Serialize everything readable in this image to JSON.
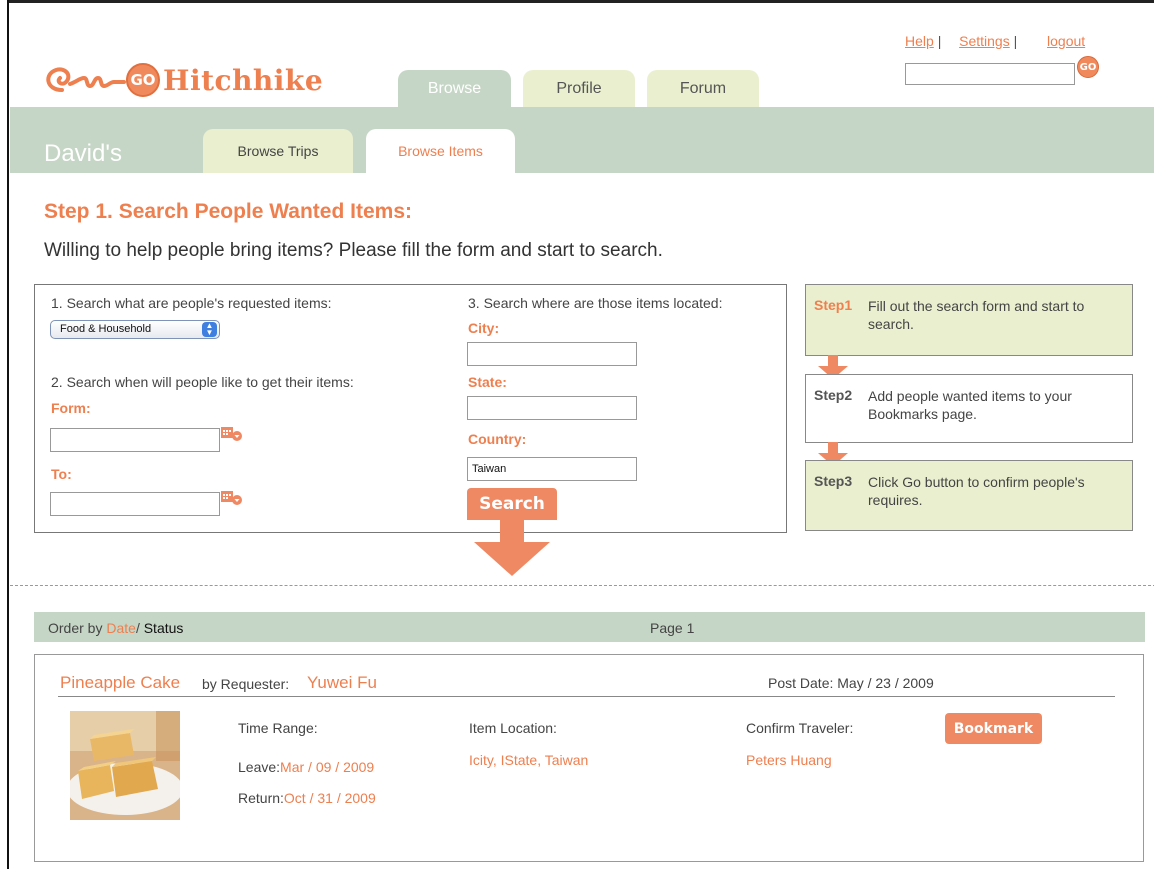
{
  "header": {
    "logo_badge": "GO",
    "logo_text": "Hitchhike",
    "main_tabs": [
      {
        "label": "Browse",
        "active": true
      },
      {
        "label": "Profile",
        "active": false
      },
      {
        "label": "Forum",
        "active": false
      }
    ],
    "links": {
      "help": "Help",
      "settings": "Settings",
      "logout": "logout",
      "separator": "|"
    },
    "search": {
      "value": "",
      "go_label": "GO"
    }
  },
  "subnav": {
    "owner": "David's",
    "tabs": [
      {
        "label": "Browse Trips",
        "active": false
      },
      {
        "label": "Browse Items",
        "active": true
      }
    ]
  },
  "step": {
    "title": "Step 1. Search People Wanted Items:",
    "subtitle": "Willing to help people bring items? Please fill the form and start to search."
  },
  "form": {
    "q1_label": "1. Search what are people's requested items:",
    "category_selected": "Food & Household",
    "q2_label": "2. Search when will people like to get their items:",
    "from_label": "Form:",
    "from_value": "",
    "to_label": "To:",
    "to_value": "",
    "q3_label": "3. Search where are those items located:",
    "city_label": "City:",
    "city_value": "",
    "state_label": "State:",
    "state_value": "",
    "country_label": "Country:",
    "country_value": "Taiwan",
    "search_button": "Search"
  },
  "steps": [
    {
      "num": "Step1",
      "text": "Fill out the search form and start to search."
    },
    {
      "num": "Step2",
      "text": "Add people wanted items to your Bookmarks page."
    },
    {
      "num": "Step3",
      "text": "Click Go button to confirm people's requires."
    }
  ],
  "results_bar": {
    "order_prefix": "Order by ",
    "order_date": "Date",
    "order_slash": "/ ",
    "order_status": "Status",
    "page": "Page 1"
  },
  "result": {
    "item_name": "Pineapple Cake",
    "by_label": "by Requester:",
    "requester": "Yuwei Fu",
    "post_date": "Post Date: May / 23 / 2009",
    "time_range_label": "Time Range:",
    "leave_label": "Leave:",
    "leave_value": "Mar / 09 / 2009",
    "return_label": "Return:",
    "return_value": "Oct / 31 / 2009",
    "location_label": "Item Location:",
    "location_value": "Icity, IState, Taiwan",
    "traveler_label": "Confirm Traveler:",
    "traveler_value": "Peters Huang",
    "bookmark_button": "Bookmark"
  },
  "colors": {
    "accent": "#ee7f4f",
    "band": "#c6d6c6",
    "tab_inactive": "#eaf0cf",
    "step_box": "#eaf0cf"
  }
}
